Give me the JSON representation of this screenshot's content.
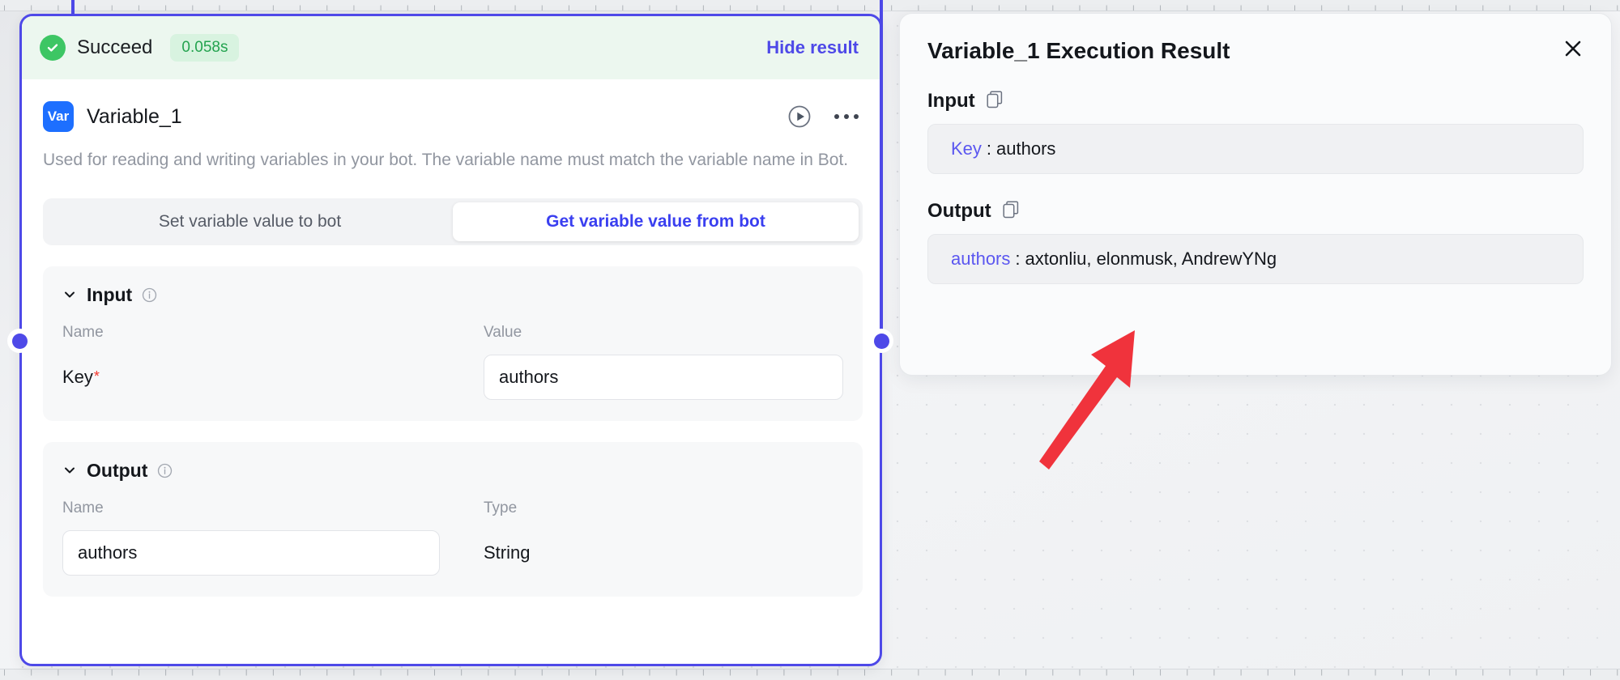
{
  "node": {
    "status": {
      "icon": "check-circle-icon",
      "label": "Succeed",
      "duration": "0.058s",
      "hide_result_label": "Hide result",
      "accent_color": "#3dc664",
      "badge_bg": "#d8f3e0",
      "strip_bg": "#ecf7ef"
    },
    "badge_text": "Var",
    "badge_color": "#1d6fff",
    "title": "Variable_1",
    "description": "Used for reading and writing variables in your bot. The variable name must match the variable name in Bot.",
    "actions": {
      "run_icon": "play-circle-icon",
      "more_icon": "more-horizontal-icon"
    },
    "mode_toggle": {
      "options": [
        "Set variable value to bot",
        "Get variable value from bot"
      ],
      "selected": "Get variable value from bot",
      "active_color": "#3a3ff0"
    },
    "input_section": {
      "title": "Input",
      "info_icon": "info-circle-icon",
      "chevron_icon": "chevron-down-icon",
      "columns": [
        "Name",
        "Value"
      ],
      "rows": [
        {
          "name": "Key",
          "required": true,
          "value": "authors"
        }
      ]
    },
    "output_section": {
      "title": "Output",
      "info_icon": "info-circle-icon",
      "chevron_icon": "chevron-down-icon",
      "columns": [
        "Name",
        "Type"
      ],
      "rows": [
        {
          "name": "authors",
          "type": "String"
        }
      ]
    },
    "border_color": "#4e49e8"
  },
  "result_panel": {
    "title": "Variable_1 Execution Result",
    "close_icon": "close-icon",
    "input": {
      "label": "Input",
      "copy_icon": "copy-icon",
      "key": "Key",
      "separator": ":",
      "value": "authors"
    },
    "output": {
      "label": "Output",
      "copy_icon": "copy-icon",
      "key": "authors",
      "separator": ":",
      "value": "axtonliu, elonmusk, AndrewYNg"
    },
    "key_color": "#5b57f0"
  },
  "annotation": {
    "arrow_icon": "red-arrow-icon",
    "color": "#f0333c"
  }
}
